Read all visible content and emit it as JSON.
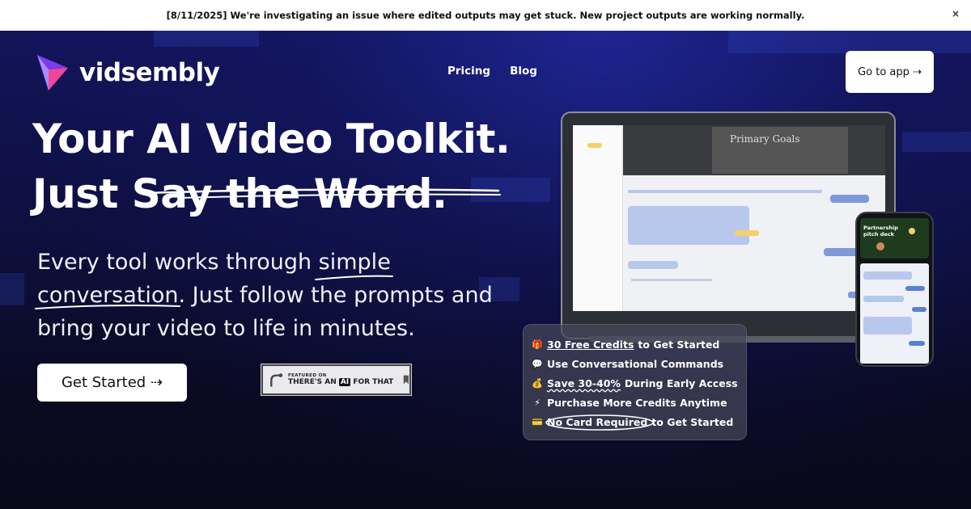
{
  "announcement": {
    "text": "[8/11/2025] We're investigating an issue where edited outputs may get stuck. New project outputs are working normally.",
    "close_icon": "×"
  },
  "brand": {
    "name": "vidsembly"
  },
  "nav": {
    "items": [
      "Pricing",
      "Blog"
    ]
  },
  "header": {
    "go_to_app_label": "Go to app ⇢"
  },
  "hero": {
    "headline_line1": "Your AI Video Toolkit.",
    "headline_line2": "Just Say the Word.",
    "sub_line1": "Every tool works through simple",
    "sub_line2": "conversation. Just follow the prompts and",
    "sub_line3": "bring your video to life in minutes.",
    "cta_label": "Get Started ⇢"
  },
  "badge": {
    "top": "FEATURED ON",
    "left": "THERE'S AN",
    "ai": "AI",
    "right": "FOR THAT"
  },
  "laptop": {
    "video_caption": "Primary Goals"
  },
  "phone": {
    "title": "Partnership pitch deck"
  },
  "features": [
    {
      "icon": "🎁",
      "link": "30 Free Credits",
      "rest": " to Get Started",
      "style": "underline"
    },
    {
      "icon": "💬",
      "link": "",
      "rest": "Use Conversational Commands",
      "style": "none"
    },
    {
      "icon": "💰",
      "link": "Save 30-40%",
      "rest": " During Early Access",
      "style": "wavy"
    },
    {
      "icon": "⚡",
      "link": "",
      "rest": "Purchase More Credits Anytime",
      "style": "none"
    },
    {
      "icon": "💳",
      "link": "No Card Required",
      "rest": " to Get Started",
      "style": "circled"
    }
  ],
  "colors": {
    "accent_purple": "#9b5cf6",
    "accent_pink": "#ec4899",
    "background": "#0b0b1e"
  }
}
